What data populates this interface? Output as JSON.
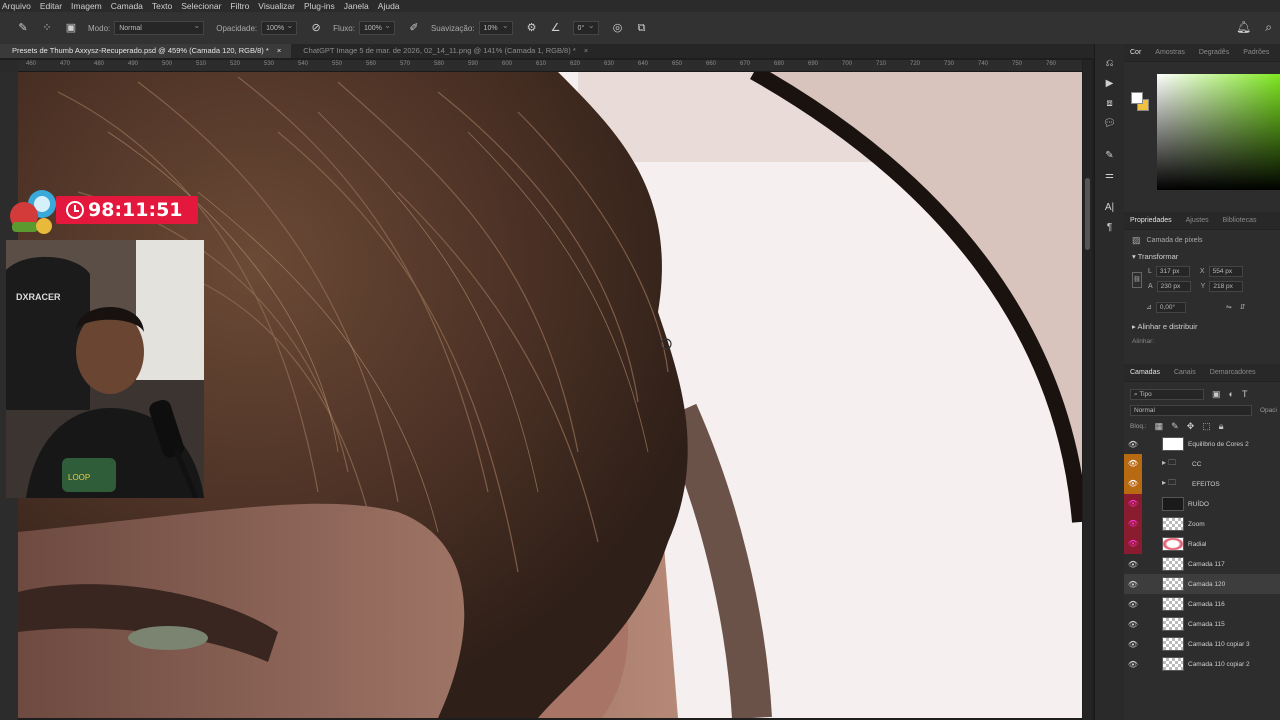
{
  "menu": [
    "Arquivo",
    "Editar",
    "Imagem",
    "Camada",
    "Texto",
    "Selecionar",
    "Filtro",
    "Visualizar",
    "Plug-ins",
    "Janela",
    "Ajuda"
  ],
  "options": {
    "mode_label": "Modo:",
    "mode_value": "Normal",
    "opacity_label": "Opacidade:",
    "opacity_value": "100%",
    "flow_label": "Fluxo:",
    "flow_value": "100%",
    "smoothing_label": "Suavização:",
    "smoothing_value": "10%",
    "angle_value": "0°"
  },
  "tabs": [
    {
      "title": "Presets de Thumb Axxysz-Recuperado.psd @ 459% (Camada 120, RGB/8) *",
      "active": true
    },
    {
      "title": "ChatGPT Image 5 de mar. de 2026, 02_14_11.png @ 141% (Camada 1, RGB/8) *",
      "active": false
    }
  ],
  "ruler_ticks": [
    "460",
    "470",
    "480",
    "490",
    "500",
    "510",
    "520",
    "530",
    "540",
    "550",
    "560",
    "570",
    "580",
    "590",
    "600",
    "610",
    "620",
    "630",
    "640",
    "650",
    "660",
    "670",
    "680",
    "690",
    "700",
    "710",
    "720",
    "730",
    "740",
    "750",
    "760"
  ],
  "timer": {
    "value": "98:11:51"
  },
  "color_panel": {
    "tabs": [
      "Cor",
      "Amostras",
      "Degradês",
      "Padrões"
    ],
    "fg": "#ffffff",
    "bg": "#f0c040"
  },
  "properties": {
    "tabs": [
      "Propriedades",
      "Ajustes",
      "Bibliotecas"
    ],
    "layer_type": "Camada de pixels",
    "transform_title": "Transformar",
    "L": "317 px",
    "X": "554 px",
    "A": "230 px",
    "Y": "218 px",
    "angle": "0,00°",
    "align_title": "Alinhar e distribuir",
    "align_label": "Alinhar:"
  },
  "layers_panel": {
    "tabs": [
      "Camadas",
      "Canais",
      "Demarcadores"
    ],
    "filter": "Tipo",
    "blend": "Normal",
    "opacity_label": "Opaci",
    "lock_label": "Bloq.:",
    "fill_label": "Pr",
    "layers": [
      {
        "name": "Equilíbrio de Cores 2",
        "kind": "adj",
        "eye": "normal"
      },
      {
        "name": "CC",
        "kind": "group",
        "eye": "orange"
      },
      {
        "name": "EFEITOS",
        "kind": "group",
        "eye": "orange"
      },
      {
        "name": "RUÍDO",
        "kind": "dark",
        "eye": "red"
      },
      {
        "name": "Zoom",
        "kind": "pixel",
        "eye": "red"
      },
      {
        "name": "Radial",
        "kind": "pixel",
        "eye": "red"
      },
      {
        "name": "Camada 117",
        "kind": "pixel",
        "eye": "normal"
      },
      {
        "name": "Camada 120",
        "kind": "pixel",
        "eye": "normal",
        "selected": true
      },
      {
        "name": "Camada 116",
        "kind": "pixel",
        "eye": "normal"
      },
      {
        "name": "Camada 115",
        "kind": "pixel",
        "eye": "normal"
      },
      {
        "name": "Camada 110 copiar 3",
        "kind": "pixel",
        "eye": "normal"
      },
      {
        "name": "Camada 110 copiar 2",
        "kind": "pixel",
        "eye": "normal"
      }
    ]
  }
}
